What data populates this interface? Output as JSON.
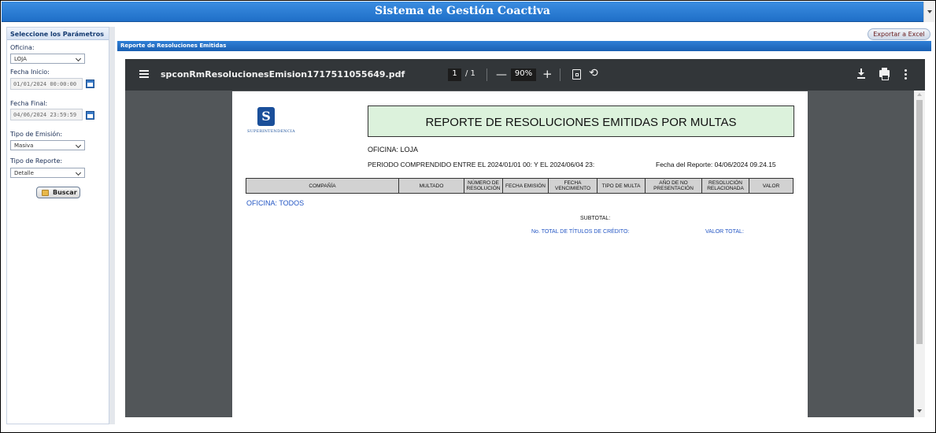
{
  "app": {
    "title": "Sistema de Gestión Coactiva"
  },
  "sidebar": {
    "header": "Seleccione los Parámetros",
    "oficina_label": "Oficina:",
    "oficina_value": "LOJA",
    "fecha_inicio_label": "Fecha Inicio:",
    "fecha_inicio_value": "01/01/2024 00:00:00",
    "fecha_final_label": "Fecha Final:",
    "fecha_final_value": "04/06/2024 23:59:59",
    "tipo_emision_label": "Tipo de Emisión:",
    "tipo_emision_value": "Masiva",
    "tipo_reporte_label": "Tipo de Reporte:",
    "tipo_reporte_value": "Detalle",
    "buscar_label": "Buscar"
  },
  "main": {
    "export_label": "Exportar a Excel",
    "panel_title": "Reporte de Resoluciones Emitidas"
  },
  "viewer": {
    "filename": "spconRmResolucionesEmision1717511055649.pdf",
    "page_current": "1",
    "page_total": "/ 1",
    "zoom": "90%",
    "minus": "—",
    "plus": "+",
    "rotate_glyph": "⟲"
  },
  "report": {
    "logo_letter": "S",
    "logo_text": "SUPERINTENDENCIA",
    "title": "REPORTE DE RESOLUCIONES EMITIDAS POR MULTAS",
    "oficina_line": "OFICINA:   LOJA",
    "periodo_line": "PERIODO COMPRENDIDO ENTRE EL  2024/01/01 00:   Y EL    2024/06/04 23:",
    "fecha_reporte": "Fecha del Reporte:     04/06/2024 09.24.15",
    "columns": [
      "COMPAÑÍA",
      "MULTADO",
      "NÚMERO DE RESOLUCIÓN",
      "FECHA EMISIÓN",
      "FECHA VENCIMIENTO",
      "TIPO DE MULTA",
      "AÑO DE NO PRESENTACIÓN",
      "RESOLUCIÓN RELACIONADA",
      "VALOR"
    ],
    "oficina_todos": "OFICINA:    TODOS",
    "subtotal": "SUBTOTAL:",
    "total_titulos": "No. TOTAL DE TÍTULOS DE CRÉDITO:",
    "valor_total": "VALOR TOTAL:"
  }
}
